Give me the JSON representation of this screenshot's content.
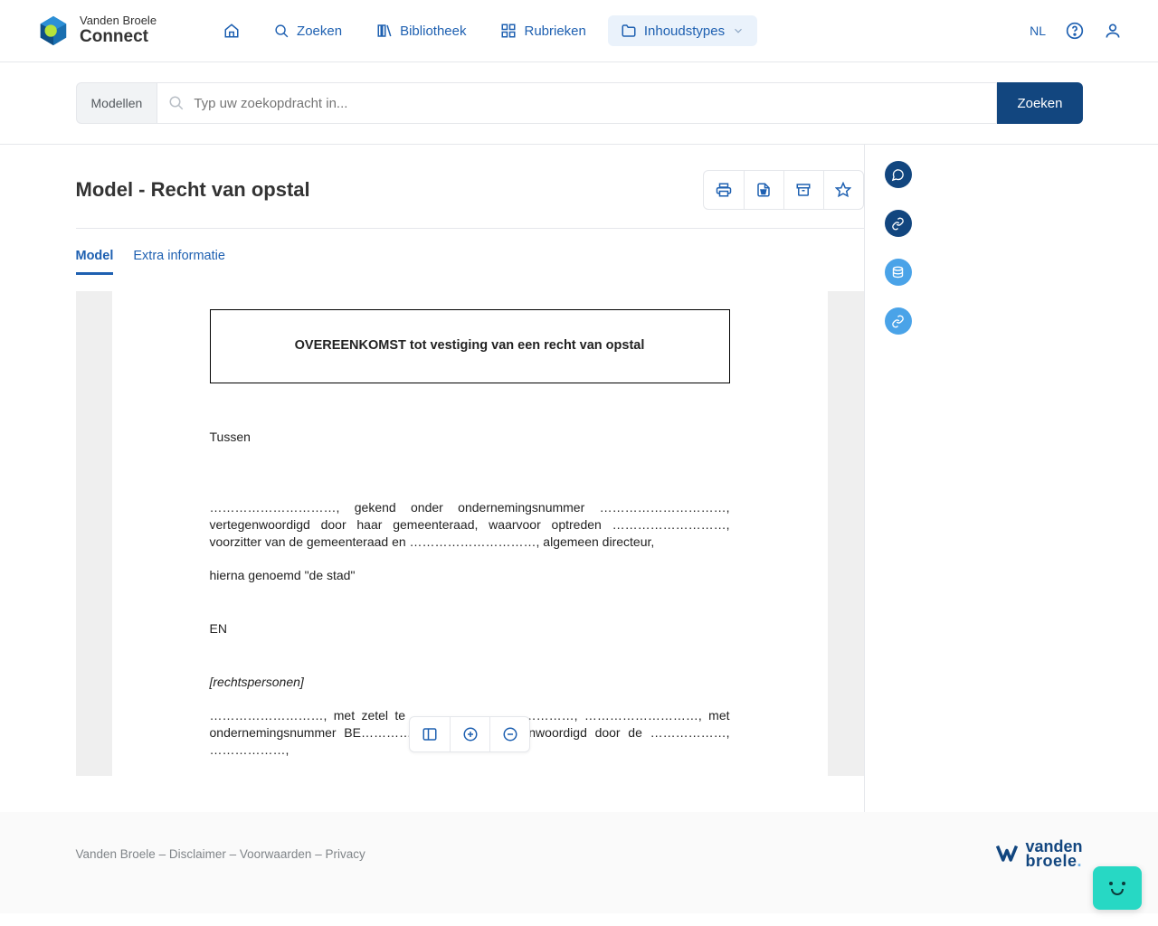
{
  "brand": {
    "name": "Vanden Broele",
    "sub": "Connect"
  },
  "nav": {
    "zoeken": "Zoeken",
    "bibliotheek": "Bibliotheek",
    "rubrieken": "Rubrieken",
    "inhoudstypes": "Inhoudstypes",
    "lang": "NL"
  },
  "search": {
    "prefix": "Modellen",
    "placeholder": "Typ uw zoekopdracht in...",
    "button": "Zoeken"
  },
  "page": {
    "title": "Model - Recht van opstal",
    "tabs": {
      "model": "Model",
      "extra": "Extra informatie"
    }
  },
  "doc": {
    "heading": "OVEREENKOMST tot vestiging van een recht van opstal",
    "tussen": "Tussen",
    "p1": "…………………………, gekend onder ondernemingsnummer …………………………, vertegenwoordigd door haar gemeenteraad, waarvoor optreden ………………………, voorzitter van de gemeenteraad en …………………………, algemeen directeur,",
    "p2": "hierna genoemd \"de stad\"",
    "en": "EN",
    "rp": "[rechtspersonen]",
    "p3": "………………………, met zetel te ………………, ………………, ………………………, met ondernemingsnummer BE………………………, vertegenwoordigd door de ………………, ………………,"
  },
  "footer": {
    "vb": "Vanden Broele",
    "disclaimer": "Disclaimer",
    "voorwaarden": "Voorwaarden",
    "privacy": "Privacy",
    "sep": " – "
  }
}
